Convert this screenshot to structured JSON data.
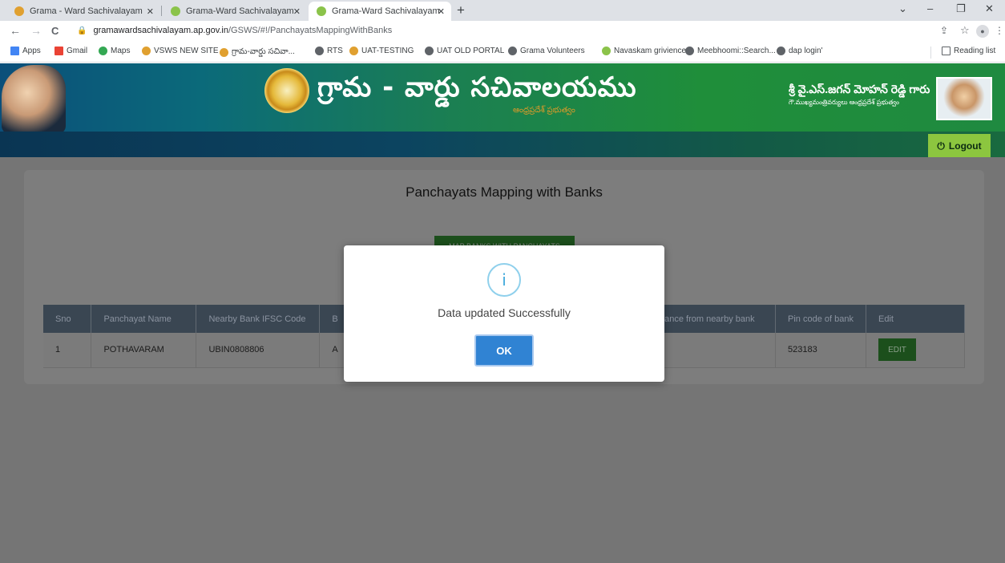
{
  "browser": {
    "tabs": [
      {
        "title": "Grama - Ward Sachivalayam"
      },
      {
        "title": "Grama-Ward Sachivalayam"
      },
      {
        "title": "Grama-Ward Sachivalayam"
      }
    ],
    "new_tab": "+",
    "window_controls": {
      "minimize": "–",
      "maximize": "❐",
      "close": "✕",
      "dropdown": "⌄"
    },
    "nav": {
      "back": "←",
      "forward": "→",
      "reload": "C"
    },
    "url": {
      "host": "gramawardsachivalayam.ap.gov.in",
      "path": "/GSWS/#!/PanchayatsMappingWithBanks"
    },
    "toolbar_icons": {
      "share": "⇪",
      "star": "☆",
      "profile": "●",
      "menu": "⋮"
    },
    "bookmarks": [
      {
        "label": "Apps",
        "icon_color": "#4285f4"
      },
      {
        "label": "Gmail",
        "icon_color": "#ea4335"
      },
      {
        "label": "Maps",
        "icon_color": "#34a853"
      },
      {
        "label": "VSWS NEW SITE",
        "icon_color": "#e0a030"
      },
      {
        "label": "గ్రామ-వార్డు సచివా...",
        "icon_color": "#e0a030"
      },
      {
        "label": "RTS",
        "icon_color": "#5f6368"
      },
      {
        "label": "UAT-TESTING",
        "icon_color": "#e0a030"
      },
      {
        "label": "UAT OLD PORTAL",
        "icon_color": "#5f6368"
      },
      {
        "label": "Grama Volunteers",
        "icon_color": "#5f6368"
      },
      {
        "label": "Navaskam grivience",
        "icon_color": "#8bc34a"
      },
      {
        "label": "Meebhoomi::Search...",
        "icon_color": "#5f6368"
      },
      {
        "label": "dap login'",
        "icon_color": "#5f6368"
      }
    ],
    "reading_list": "Reading list"
  },
  "header": {
    "title": "గ్రామ - వార్డు సచివాలయము",
    "subtitle": "ఆంధ్రప్రదేశ్ ప్రభుత్వం",
    "cm_name": "శ్రీ వై.ఎస్.జగన్ మోహన్ రెడ్డి గారు",
    "cm_title": "గౌ.ముఖ్యమంత్రివర్యులు ఆంధ్రప్రదేశ్ ప్రభుత్వం",
    "logout_icon": "⏻",
    "logout_label": "Logout"
  },
  "main": {
    "page_title": "Panchayats Mapping with Banks",
    "map_button_label": "MAP BANKS WITH PANCHAYATS",
    "table": {
      "headers": [
        "Sno",
        "Panchayat Name",
        "Nearby Bank IFSC Code",
        "B",
        "",
        "ance from nearby bank",
        "Pin code of bank",
        "Edit"
      ],
      "rows": [
        {
          "sno": "1",
          "panchayat": "POTHAVARAM",
          "ifsc": "UBIN0808806",
          "bank": "A",
          "col5": "",
          "distance": "",
          "pincode": "523183",
          "edit_label": "EDIT"
        }
      ]
    }
  },
  "modal": {
    "icon": "i",
    "message": "Data updated Successfully",
    "ok_label": "OK"
  }
}
